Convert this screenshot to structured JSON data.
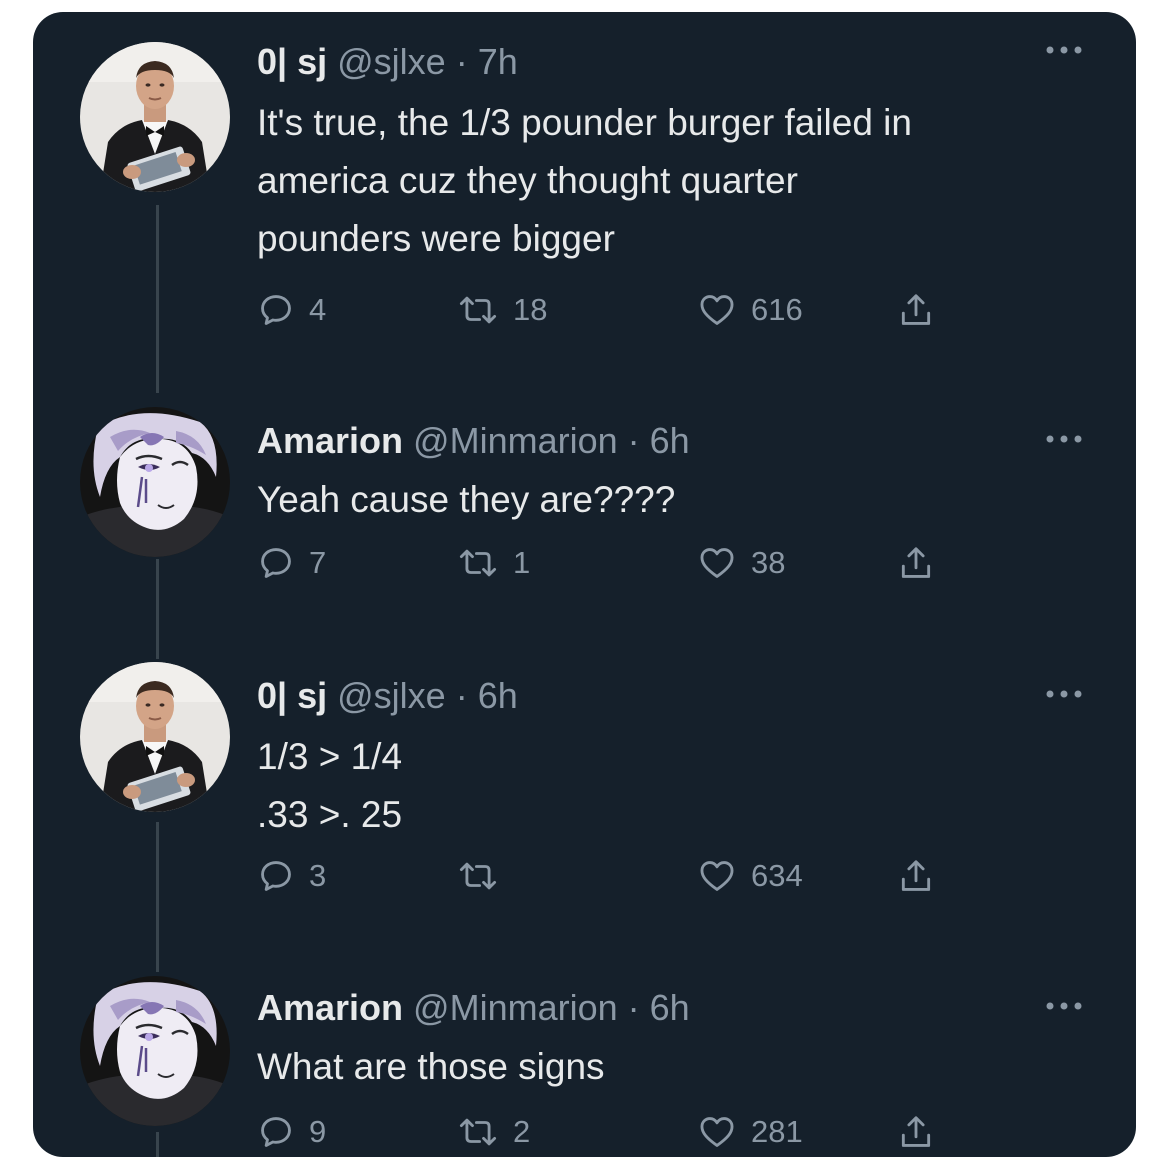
{
  "colors": {
    "background": "#15202b",
    "primary_text": "#e7e9ea",
    "secondary_text": "#8b98a5",
    "thread_line": "#38444d"
  },
  "tweets": [
    {
      "display_name": "0| sj",
      "handle_time": "@sjlxe · 7h",
      "text": "It's true, the 1/3 pounder burger failed in\namerica cuz they thought quarter\npounders were bigger",
      "reply_count": "4",
      "retweet_count": "18",
      "like_count": "616",
      "avatar": "man-in-tuxedo"
    },
    {
      "display_name": "Amarion",
      "handle_time": "@Minmarion · 6h",
      "text": "Yeah cause they are????",
      "reply_count": "7",
      "retweet_count": "1",
      "like_count": "38",
      "avatar": "anime-character"
    },
    {
      "display_name": "0| sj",
      "handle_time": "@sjlxe · 6h",
      "text": "1/3 > 1/4\n.33 >. 25",
      "reply_count": "3",
      "retweet_count": "",
      "like_count": "634",
      "avatar": "man-in-tuxedo"
    },
    {
      "display_name": "Amarion",
      "handle_time": "@Minmarion · 6h",
      "text": "What are those signs",
      "reply_count": "9",
      "retweet_count": "2",
      "like_count": "281",
      "avatar": "anime-character"
    }
  ],
  "icons": {
    "reply": "speech-bubble-icon",
    "retweet": "retweet-arrows-icon",
    "like": "heart-icon",
    "share": "share-upload-icon",
    "more": "more-dots-icon"
  }
}
